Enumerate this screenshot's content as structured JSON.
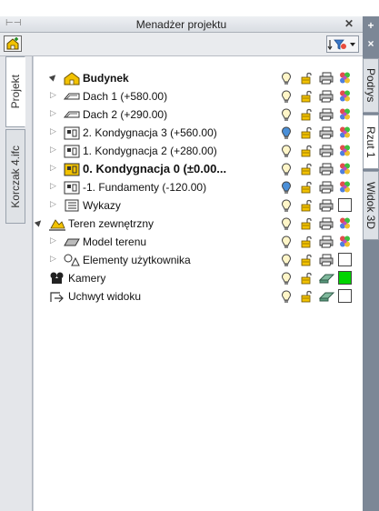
{
  "window": {
    "title": "Menadżer projektu",
    "pin_glyph": "⊢⊣",
    "close_glyph": "✕"
  },
  "left_tabs": [
    {
      "label": "Projekt",
      "active": true
    },
    {
      "label": "Korczak 4.ifc",
      "active": false
    }
  ],
  "right_strip": {
    "buttons": [
      {
        "glyph": "+"
      },
      {
        "glyph": "×"
      }
    ],
    "tabs": [
      {
        "label": "Podrys",
        "active": false
      },
      {
        "label": "Rzut 1",
        "active": true
      },
      {
        "label": "Widok 3D",
        "active": false
      }
    ]
  },
  "tree": [
    {
      "label": "Budynek",
      "style": "bold",
      "arrow": "▲",
      "icon": "building-icon",
      "swatch": "multi"
    },
    {
      "label": "Dach 1 (+580.00)",
      "arrow": "▷",
      "icon": "roof-icon",
      "swatch": "multi"
    },
    {
      "label": "Dach 2 (+290.00)",
      "arrow": "▷",
      "icon": "roof-icon",
      "swatch": "multi"
    },
    {
      "label": "2. Kondygnacja 3 (+560.00)",
      "arrow": "▷",
      "icon": "storey-icon",
      "swatch": "multi",
      "bulb": "blue"
    },
    {
      "label": "1. Kondygnacja 2 (+280.00)",
      "arrow": "▷",
      "icon": "storey-icon",
      "swatch": "multi"
    },
    {
      "label": "0. Kondygnacja 0 (±0.00...",
      "style": "big",
      "arrow": "▷",
      "icon": "storey-active-icon",
      "swatch": "multi"
    },
    {
      "label": "-1. Fundamenty (-120.00)",
      "arrow": "▷",
      "icon": "storey-icon",
      "swatch": "multi",
      "bulb": "blue"
    },
    {
      "label": "Wykazy",
      "arrow": "▷",
      "icon": "list-icon",
      "swatch": "white"
    },
    {
      "label": "Teren zewnętrzny",
      "arrow": "▲",
      "icon": "terrain-icon",
      "swatch": "multi"
    },
    {
      "label": "Model terenu",
      "arrow": "▷",
      "icon": "terrain-model-icon",
      "swatch": "multi"
    },
    {
      "label": "Elementy użytkownika",
      "arrow": "▷",
      "icon": "user-elements-icon",
      "swatch": "white"
    },
    {
      "label": "Kamery",
      "arrow": "",
      "icon": "camera-icon",
      "swatch": "green",
      "third": "eraser"
    },
    {
      "label": "Uchwyt widoku",
      "arrow": "",
      "icon": "view-handle-icon",
      "swatch": "white",
      "third": "eraser"
    }
  ],
  "colors": {
    "accent_yellow": "#f2c200",
    "swatch_green": "#00d400",
    "bulb_blue": "#4a8fd8",
    "tab_strip": "#7c8796"
  }
}
